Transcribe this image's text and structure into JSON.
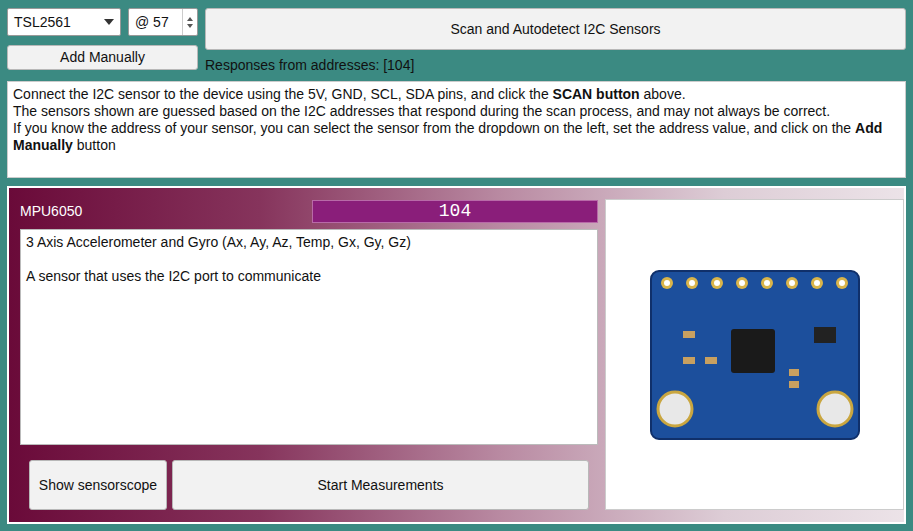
{
  "sensor_select": {
    "value": "TSL2561"
  },
  "address_input": {
    "value": "@ 57"
  },
  "scan_button": "Scan and Autodetect I2C Sensors",
  "add_manually_button": "Add Manually",
  "responses": "Responses from addresses: [104]",
  "info": [
    {
      "runs": [
        {
          "text": "Connect the I2C sensor to the device using the 5V, GND, SCL, SDA pins, and click the ",
          "bold": false
        },
        {
          "text": "SCAN button",
          "bold": true
        },
        {
          "text": " above.",
          "bold": false
        }
      ]
    },
    {
      "runs": [
        {
          "text": "The sensors shown are guessed based on the I2C addresses that respond during the scan process, and may not always be correct.",
          "bold": false
        }
      ]
    },
    {
      "runs": [
        {
          "text": "If you know the address of your sensor, you can select the sensor from the dropdown on the left, set the address value, and click on the ",
          "bold": false
        },
        {
          "text": "Add Manually",
          "bold": true
        },
        {
          "text": " button",
          "bold": false
        }
      ]
    }
  ],
  "sensor_card": {
    "name": "MPU6050",
    "address": "104",
    "description": [
      "3 Axis Accelerometer and Gyro (Ax, Ay, Az, Temp, Gx, Gy, Gz)",
      "A sensor that uses the I2C port to communicate"
    ],
    "buttons": [
      "Show sensorscope",
      "Start Measurements"
    ]
  }
}
